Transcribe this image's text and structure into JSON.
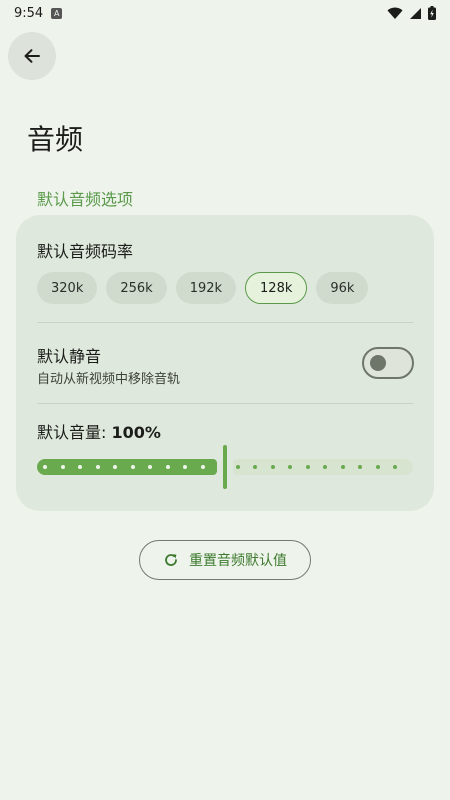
{
  "status_bar": {
    "time": "9:54",
    "notification_badge": "A"
  },
  "header": {
    "back_icon": "arrow-left-icon"
  },
  "page": {
    "title": "音频"
  },
  "section": {
    "title": "默认音频选项"
  },
  "bitrate": {
    "title": "默认音频码率",
    "options": [
      "320k",
      "256k",
      "192k",
      "128k",
      "96k"
    ],
    "selected": "128k"
  },
  "mute": {
    "title": "默认静音",
    "subtitle": "自动从新视频中移除音轨",
    "enabled": false
  },
  "volume": {
    "label": "默认音量: ",
    "value_text": "100%",
    "slider_fraction": 0.5
  },
  "reset": {
    "label": "重置音频默认值",
    "icon": "refresh-icon"
  },
  "colors": {
    "accent": "#5a9a4a",
    "slider_active": "#6aaa4f",
    "slider_inactive": "#d6e4d0",
    "background": "#eef3ec",
    "card": "#dfe8dc"
  }
}
